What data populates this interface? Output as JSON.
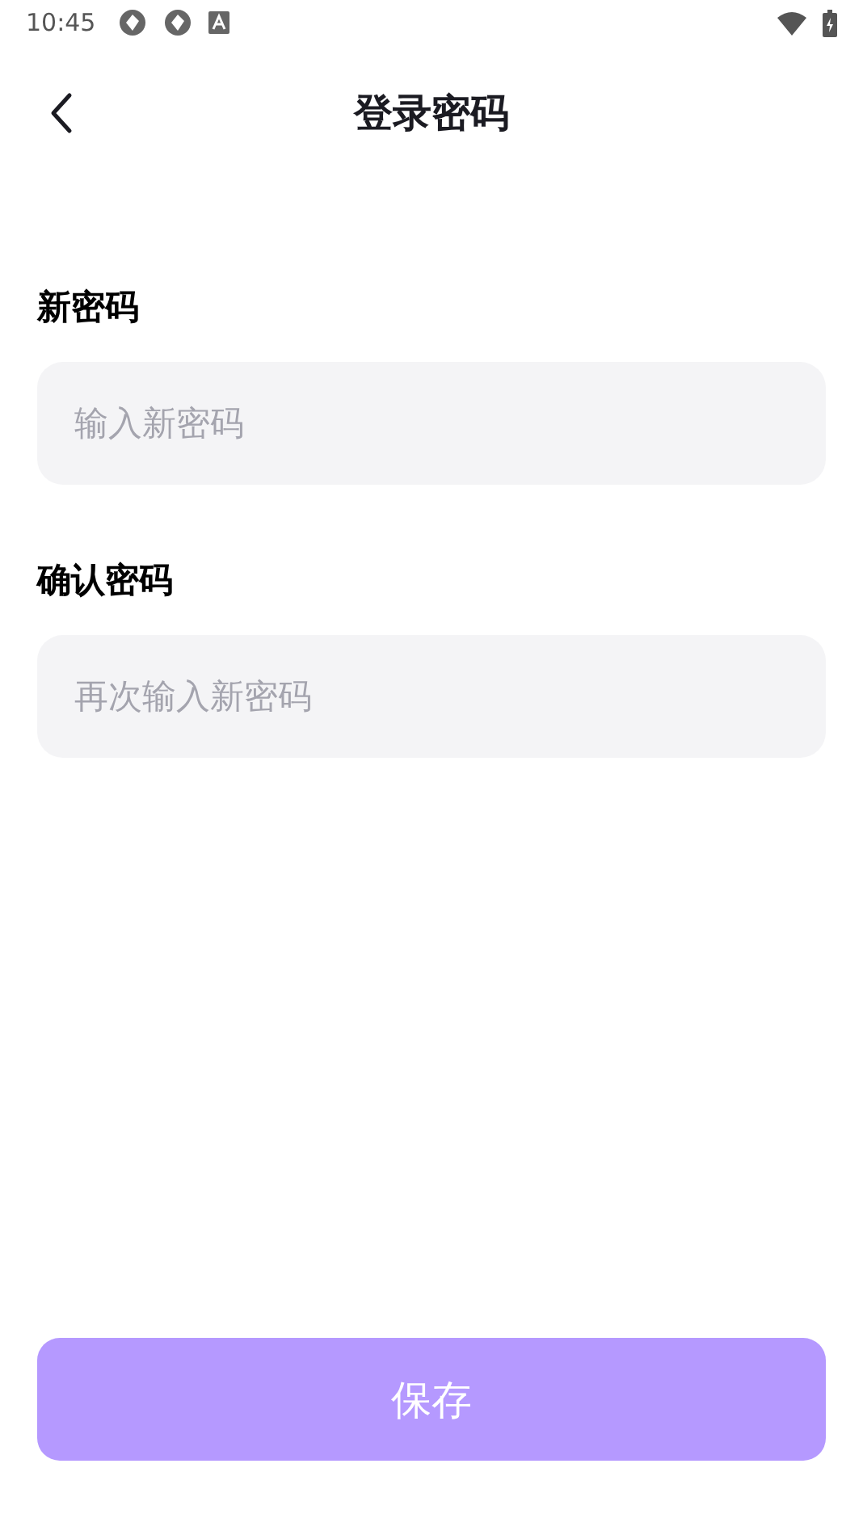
{
  "status_bar": {
    "time": "10:45"
  },
  "header": {
    "title": "登录密码"
  },
  "fields": [
    {
      "label": "新密码",
      "placeholder": "输入新密码"
    },
    {
      "label": "确认密码",
      "placeholder": "再次输入新密码"
    }
  ],
  "save_button": {
    "label": "保存",
    "disabled": true
  }
}
